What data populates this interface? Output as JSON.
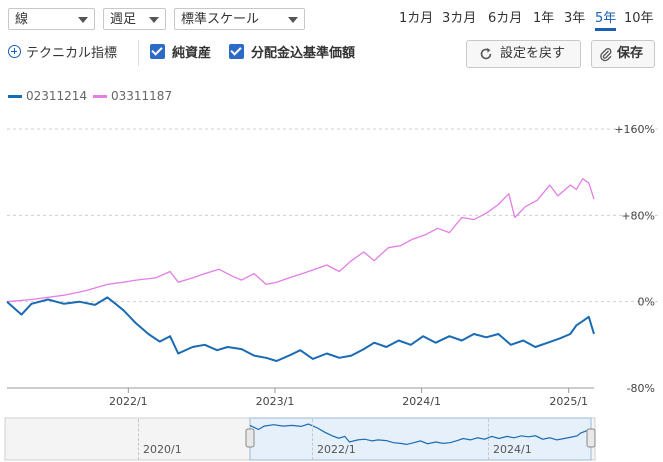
{
  "controls": {
    "chart_type": "線",
    "interval": "週足",
    "scale": "標準スケール",
    "periods": [
      "1カ月",
      "3カ月",
      "6カ月",
      "1年",
      "3年",
      "5年",
      "10年"
    ],
    "active_period": "5年",
    "technical_label": "テクニカル指標",
    "checkbox_nav": "純資産",
    "checkbox_dist": "分配金込基準価額",
    "reset_label": "設定を戻す",
    "save_label": "保存"
  },
  "colors": {
    "series1": "#1a6bb3",
    "series2": "#e27ee6",
    "accent": "#1a5fb4",
    "navigator_fill": "#e6f0fb"
  },
  "chart_data": {
    "type": "line",
    "title": "",
    "xlabel": "",
    "ylabel": "",
    "y_unit": "%",
    "ylim": [
      -80,
      160
    ],
    "yticks": [
      "+160%",
      "+80%",
      "0%",
      "-80%"
    ],
    "ytick_values": [
      160,
      80,
      0,
      -80
    ],
    "xlim": [
      "2021-03-05",
      "2025-03-05"
    ],
    "xticks": [
      "2022/1",
      "2023/1",
      "2024/1",
      "2025/1"
    ],
    "xtick_dates": [
      "2022-01-01",
      "2023-01-01",
      "2024-01-01",
      "2025-01-01"
    ],
    "grid": "horizontal dashed",
    "legend_position": "top-left",
    "series": [
      {
        "name": "02311214",
        "color": "#1a6bb3",
        "x": [
          "2021-03-05",
          "2021-04-10",
          "2021-05-05",
          "2021-06-15",
          "2021-07-25",
          "2021-09-01",
          "2021-10-10",
          "2021-11-10",
          "2021-11-30",
          "2021-12-20",
          "2022-01-20",
          "2022-02-20",
          "2022-03-20",
          "2022-04-15",
          "2022-05-05",
          "2022-06-10",
          "2022-07-10",
          "2022-08-10",
          "2022-09-05",
          "2022-10-10",
          "2022-11-10",
          "2022-12-10",
          "2023-01-05",
          "2023-02-05",
          "2023-03-05",
          "2023-04-05",
          "2023-05-10",
          "2023-06-10",
          "2023-07-10",
          "2023-08-10",
          "2023-09-05",
          "2023-10-05",
          "2023-11-05",
          "2023-12-05",
          "2024-01-05",
          "2024-02-05",
          "2024-03-10",
          "2024-04-10",
          "2024-05-10",
          "2024-06-10",
          "2024-07-10",
          "2024-08-10",
          "2024-09-10",
          "2024-10-10",
          "2024-11-10",
          "2024-12-10",
          "2025-01-05",
          "2025-01-20",
          "2025-02-05",
          "2025-02-20",
          "2025-03-05"
        ],
        "values": [
          0,
          -12,
          -2,
          2,
          -2,
          0,
          -3,
          4,
          -2,
          -8,
          -20,
          -30,
          -37,
          -32,
          -48,
          -42,
          -40,
          -45,
          -42,
          -44,
          -50,
          -52,
          -55,
          -50,
          -45,
          -53,
          -48,
          -52,
          -50,
          -44,
          -38,
          -42,
          -36,
          -40,
          -32,
          -38,
          -32,
          -36,
          -30,
          -33,
          -30,
          -40,
          -36,
          -42,
          -38,
          -34,
          -30,
          -22,
          -18,
          -14,
          -30
        ]
      },
      {
        "name": "03311187",
        "color": "#e27ee6",
        "x": [
          "2021-03-05",
          "2021-05-05",
          "2021-07-25",
          "2021-09-15",
          "2021-11-10",
          "2021-12-20",
          "2022-01-20",
          "2022-03-10",
          "2022-04-15",
          "2022-05-05",
          "2022-06-10",
          "2022-07-10",
          "2022-08-15",
          "2022-09-15",
          "2022-10-10",
          "2022-11-10",
          "2022-12-10",
          "2023-01-05",
          "2023-02-05",
          "2023-03-10",
          "2023-04-10",
          "2023-05-10",
          "2023-06-10",
          "2023-07-10",
          "2023-08-10",
          "2023-09-05",
          "2023-10-10",
          "2023-11-10",
          "2023-12-10",
          "2024-01-10",
          "2024-02-10",
          "2024-03-10",
          "2024-04-10",
          "2024-05-10",
          "2024-06-10",
          "2024-07-10",
          "2024-08-05",
          "2024-08-20",
          "2024-09-15",
          "2024-10-15",
          "2024-11-15",
          "2024-12-05",
          "2025-01-05",
          "2025-01-20",
          "2025-02-05",
          "2025-02-20",
          "2025-03-05"
        ],
        "values": [
          0,
          2,
          6,
          10,
          16,
          18,
          20,
          22,
          28,
          18,
          22,
          26,
          30,
          24,
          20,
          26,
          16,
          18,
          22,
          26,
          30,
          34,
          28,
          38,
          46,
          38,
          50,
          52,
          58,
          62,
          68,
          64,
          78,
          76,
          82,
          90,
          100,
          78,
          88,
          94,
          108,
          98,
          108,
          104,
          114,
          110,
          95
        ]
      }
    ]
  }
}
